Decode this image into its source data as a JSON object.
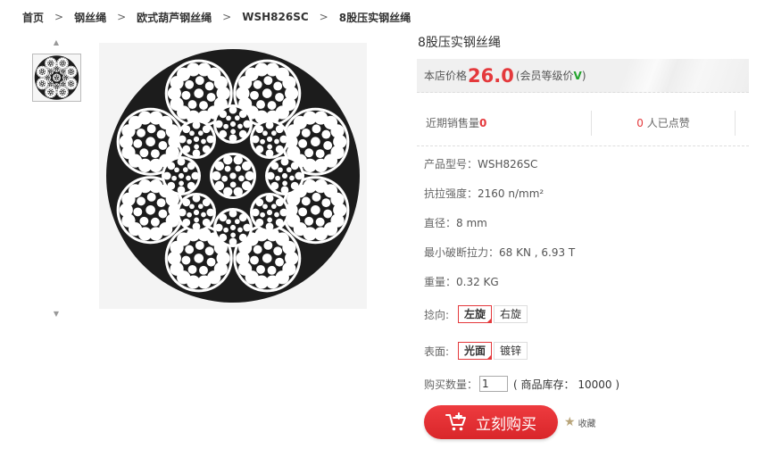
{
  "breadcrumb": [
    "首页",
    "钢丝绳",
    "欧式葫芦钢丝绳",
    "WSH826SC",
    "8股压实钢丝绳"
  ],
  "breadcrumb_sep": ">",
  "gallery": {
    "up_arrow": "▲",
    "down_arrow": "▼"
  },
  "product": {
    "title": "8股压实钢丝绳",
    "price_label": "本店价格",
    "price": "26.0",
    "price_note_pre": "(会员等级价",
    "price_note_v": "V",
    "price_note_post": ")",
    "sales_label": "近期销售量",
    "sales_count": "0",
    "likes_count": "0",
    "likes_label": "人已点赞",
    "specs": [
      {
        "label": "产品型号：",
        "value": "WSH826SC"
      },
      {
        "label": "抗拉强度：",
        "value": "2160 n/mm²"
      },
      {
        "label": "直径：",
        "value": "8 mm"
      },
      {
        "label": "最小破断拉力：",
        "value": "68 KN , 6.93 T"
      },
      {
        "label": "重量：",
        "value": "0.32 KG"
      }
    ],
    "lay_label": "捻向:",
    "lay_options": [
      "左旋",
      "右旋"
    ],
    "surface_label": "表面:",
    "surface_options": [
      "光面",
      "镀锌"
    ],
    "qty_label": "购买数量：",
    "qty_value": "1",
    "stock_text": "( 商品库存： 10000 )",
    "buy_label": "立刻购买",
    "fav_label": "收藏"
  },
  "colors": {
    "accent": "#e4393c",
    "vip_green": "#22a32b"
  },
  "icons": {
    "cart": "cart-icon",
    "star": "star-icon",
    "up": "arrow-up-icon",
    "down": "arrow-down-icon"
  }
}
